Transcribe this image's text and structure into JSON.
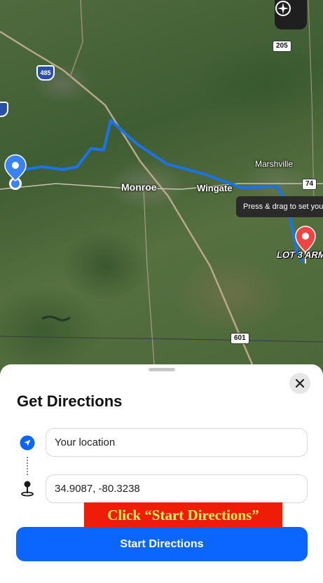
{
  "map": {
    "places": {
      "monroe": "Monroe",
      "wingate": "Wingate",
      "marshville": "Marshville"
    },
    "shields": {
      "i485": "485",
      "i_left": "I",
      "hwy205": "205",
      "hwy74": "74",
      "hwy601": "601"
    },
    "compass_icon": "compass-icon",
    "tooltip": "Press & drag to set your",
    "destination_label": "LOT 3 ARM",
    "route_color": "#1a73e8",
    "pin_origin_color": "#3b82f6",
    "pin_dest_color": "#ef4444"
  },
  "sheet": {
    "title": "Get Directions",
    "close_icon": "close-icon",
    "origin": {
      "icon": "navigation-arrow-icon",
      "value": "Your location"
    },
    "destination": {
      "icon": "location-pin-icon",
      "value": "34.9087, -80.3238"
    },
    "annotation": "Click “Start Directions”",
    "start_button_label": "Start Directions",
    "accent": "#0a66ff"
  }
}
